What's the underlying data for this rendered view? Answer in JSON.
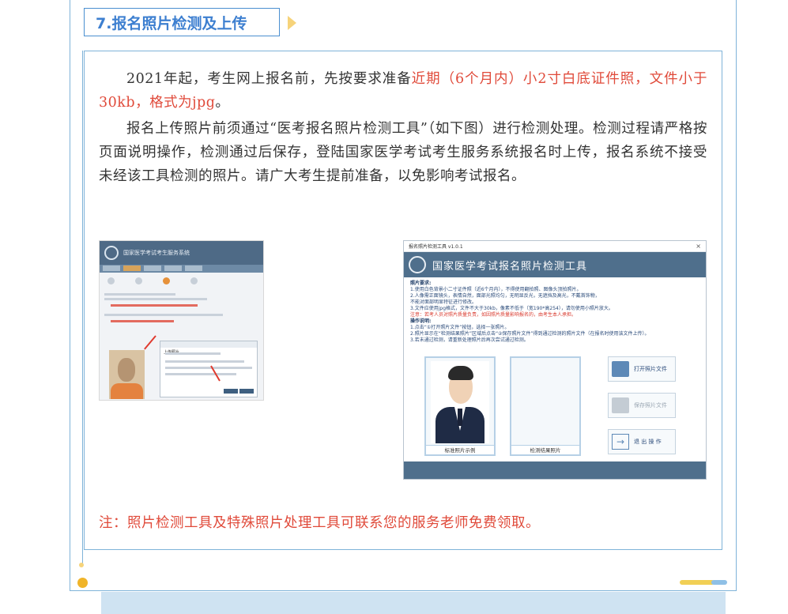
{
  "section": {
    "title": "7.报名照片检测及上传"
  },
  "paragraph1": {
    "text_plain": "2021年起，考生网上报名前，先按要求准备",
    "text_red": "近期（6个月内）小2寸白底证件照，文件小于30kb，格式为jpg",
    "text_end": "。"
  },
  "paragraph2": {
    "text": "报名上传照片前须通过“医考报名照片检测工具”（如下图）进行检测处理。检测过程请严格按页面说明操作，检测通过后保存，登陆国家医学考试考生服务系统报名时上传，报名系统不接受未经该工具检测的照片。请广大考生提前准备，以免影响考试报名。"
  },
  "screenshot_left": {
    "header_title": "国家医学考试考生服务系统",
    "dialog_title": "上传照片"
  },
  "screenshot_right": {
    "window_title": "报名照片检测工具 v1.0.1",
    "close_glyph": "×",
    "banner_title": "国家医学考试报名照片检测工具",
    "requirements_heading": "照片要求:",
    "requirements": [
      "1.使用白色背景小二寸证件照（近6个月内），不得使用翻拍照、图像头顶拍照片。",
      "2.人像需正面镜头，表情自然，面部光照均匀，无明显反光，无遮挡及高光，不戴首饰物，",
      "不能对面部明显特征进行修改。",
      "3.文件应使用jpg格式，文件不大于30kb，像素不低于（宽190*高254），请勿使用小照片放大。"
    ],
    "requirements_warning": "注意：若考人员对照片质量负责，如因照片质量影响报名的，由考生本人承担。",
    "instructions_heading": "操作说明:",
    "instructions": [
      "1.点击“①打开照片文件”按钮，选择一张照片。",
      "2.照片显示在“检测结果照片”区域后点击“②保存照片文件”得到通过检测的照片文件（在报名时使用该文件上传）。",
      "3.若未通过检测，请重新处理照片后再次尝试通过检测。"
    ],
    "panel_sample_label": "标准照片示例",
    "panel_result_label": "检测结果照片",
    "btn_open": "打开照片文件",
    "btn_save": "保存照片文件",
    "btn_exit": "退 出 操 作"
  },
  "note": {
    "text": "注：照片检测工具及特殊照片处理工具可联系您的服务老师免费领取。"
  }
}
